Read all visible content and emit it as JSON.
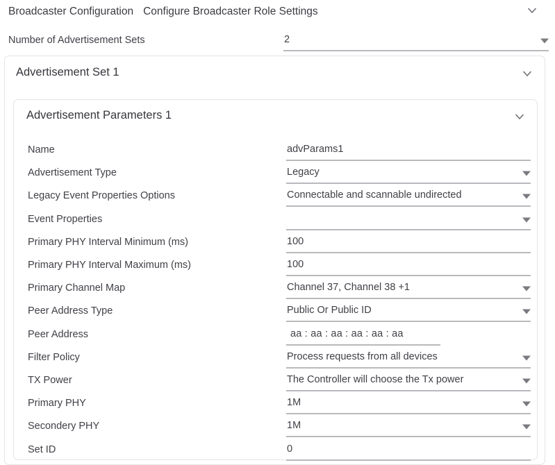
{
  "header": {
    "title": "Broadcaster Configuration",
    "subtitle": "Configure Broadcaster Role Settings",
    "collapse_icon": "chevron-down-icon"
  },
  "top_field": {
    "label": "Number of Advertisement Sets",
    "value": "2",
    "type": "select",
    "dropdown_icon": "triangle-down-icon"
  },
  "advertisement_set": {
    "title": "Advertisement Set 1",
    "collapse_icon": "chevron-down-icon"
  },
  "advertisement_parameters": {
    "title": "Advertisement Parameters 1",
    "collapse_icon": "chevron-down-icon",
    "fields": [
      {
        "label": "Name",
        "value": "advParams1",
        "type": "text"
      },
      {
        "label": "Advertisement Type",
        "value": "Legacy",
        "type": "select"
      },
      {
        "label": "Legacy Event Properties Options",
        "value": "Connectable and scannable undirected",
        "type": "select"
      },
      {
        "label": "Event Properties",
        "value": "",
        "type": "select"
      },
      {
        "label": "Primary PHY Interval Minimum (ms)",
        "value": "100",
        "type": "text"
      },
      {
        "label": "Primary PHY Interval Maximum (ms)",
        "value": "100",
        "type": "text"
      },
      {
        "label": "Primary Channel Map",
        "value": "Channel 37, Channel 38 +1",
        "type": "select"
      },
      {
        "label": "Peer Address Type",
        "value": "Public Or Public ID",
        "type": "select"
      },
      {
        "label": "Peer Address",
        "value": "aa : aa : aa : aa : aa : aa",
        "type": "mac"
      },
      {
        "label": "Filter Policy",
        "value": "Process requests from all devices",
        "type": "select"
      },
      {
        "label": "TX Power",
        "value": "The Controller will choose the Tx power",
        "type": "select"
      },
      {
        "label": "Primary PHY",
        "value": "1M",
        "type": "select"
      },
      {
        "label": "Secondery PHY",
        "value": "1M",
        "type": "select"
      },
      {
        "label": "Set ID",
        "value": "0",
        "type": "text"
      }
    ]
  },
  "colors": {
    "text": "#3f3f46",
    "heading": "#36363c",
    "underline": "#b9b9bd",
    "card_border": "#e4e4e7",
    "icon": "#7a7a80",
    "background": "#ffffff"
  }
}
